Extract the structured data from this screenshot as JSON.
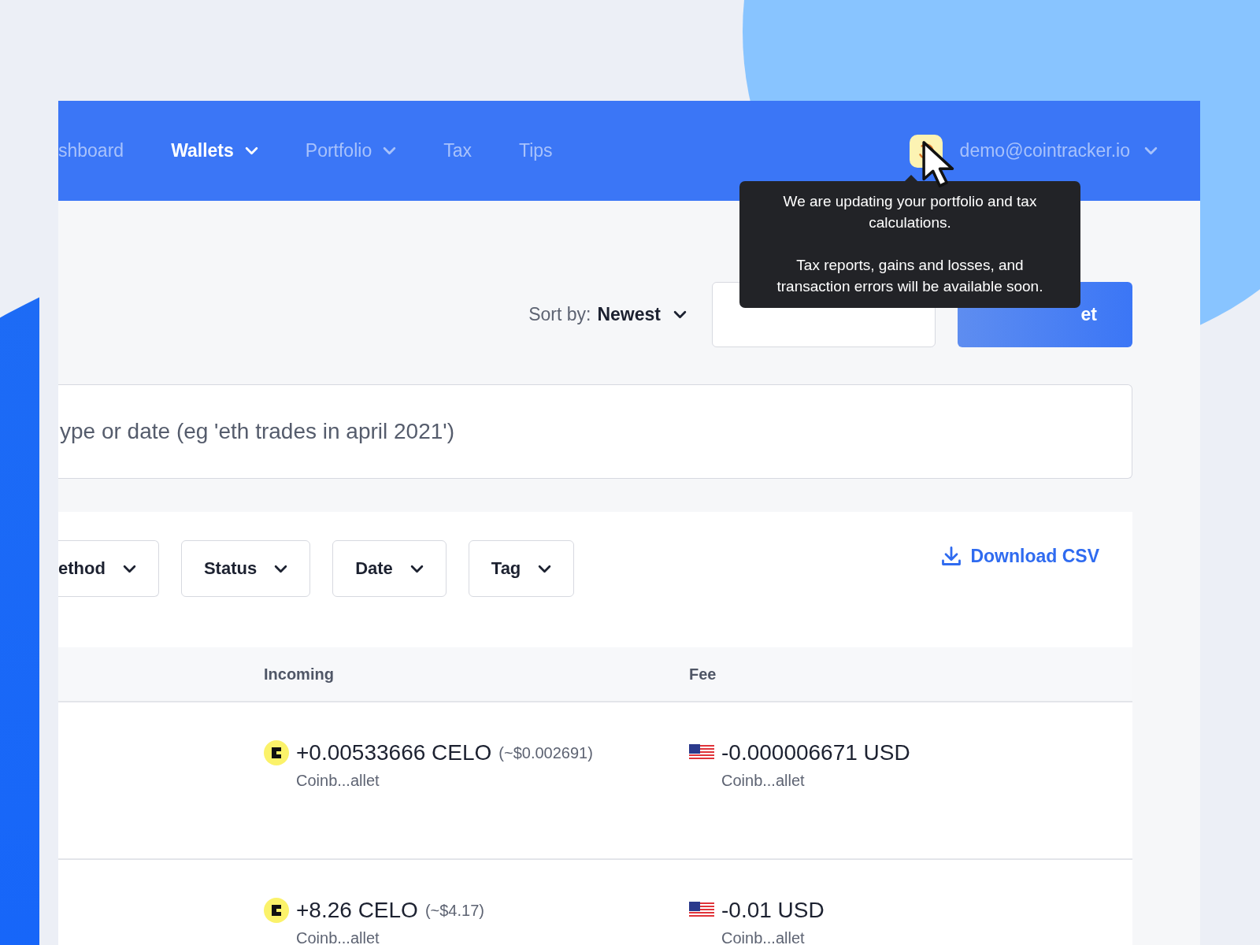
{
  "nav": {
    "items": [
      {
        "label": "shboard",
        "selected": false,
        "dropdown": false
      },
      {
        "label": "Wallets",
        "selected": true,
        "dropdown": true
      },
      {
        "label": "Portfolio",
        "selected": false,
        "dropdown": true
      },
      {
        "label": "Tax",
        "selected": false,
        "dropdown": false
      },
      {
        "label": "Tips",
        "selected": false,
        "dropdown": false
      }
    ],
    "account": {
      "email": "demo@cointracker.io"
    }
  },
  "tooltip": {
    "paragraphs": [
      "We are updating your portfolio and tax calculations.",
      "Tax reports, gains and losses, and transaction errors will be available soon."
    ]
  },
  "toolbar": {
    "sort_label": "Sort by:",
    "sort_value": "Newest",
    "button_label": "et"
  },
  "search": {
    "placeholder": "ype or date (eg 'eth trades in april 2021')"
  },
  "filters": [
    "ethod",
    "Status",
    "Date",
    "Tag"
  ],
  "download": "Download CSV",
  "table": {
    "columns": [
      "Incoming",
      "Fee"
    ],
    "rows": [
      {
        "incoming": {
          "amount": "+0.00533666 CELO",
          "approx": "(~$0.002691)",
          "wallet": "Coinb...allet"
        },
        "fee": {
          "amount": "-0.000006671 USD",
          "wallet": "Coinb...allet"
        }
      },
      {
        "incoming": {
          "amount": "+8.26 CELO",
          "approx": "(~$4.17)",
          "wallet": "Coinb...allet"
        },
        "fee": {
          "amount": "-0.01 USD",
          "wallet": "Coinb...allet"
        }
      }
    ]
  }
}
